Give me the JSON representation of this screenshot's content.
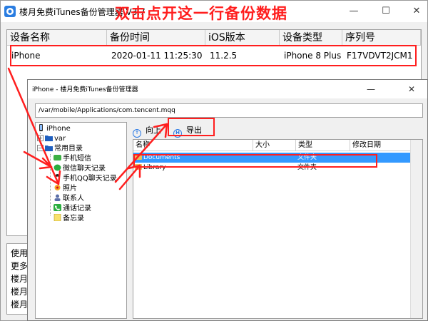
{
  "main_window": {
    "title": "楼月免费iTunes备份管理器 V3.7",
    "controls": {
      "minimize": "—",
      "maximize": "☐",
      "close": "✕"
    }
  },
  "annotation": {
    "caption": "双击点开这一行备份数据"
  },
  "backup_table": {
    "columns": [
      "设备名称",
      "备份时间",
      "iOS版本",
      "设备类型",
      "序列号"
    ],
    "rows": [
      {
        "device": "iPhone",
        "time": "2020-01-11  11:25:30",
        "ios": "11.2.5",
        "type": "iPhone 8 Plus",
        "serial": "F17VDVT2JCM1"
      }
    ]
  },
  "side_panel": {
    "lines": [
      "使用说",
      "更多软",
      "楼月微",
      "楼月手",
      "楼月手"
    ]
  },
  "dialog": {
    "title": "iPhone - 楼月免费iTunes备份管理器",
    "controls": {
      "minimize": "—",
      "close": "✕"
    },
    "path": "/var/mobile/Applications/com.tencent.mqq",
    "toolbar": {
      "up_label": "向上",
      "export_label": "导出"
    },
    "tree": {
      "root": "iPhone",
      "var": "var",
      "common": "常用目录",
      "items": [
        "手机短信",
        "微信聊天记录",
        "手机QQ聊天记录",
        "照片",
        "联系人",
        "通话记录",
        "备忘录"
      ]
    },
    "file_list": {
      "columns": [
        "名称",
        "大小",
        "类型",
        "修改日期"
      ],
      "rows": [
        {
          "name": "Documents",
          "size": "",
          "type": "文件夹",
          "date": ""
        },
        {
          "name": "Library",
          "size": "",
          "type": "文件夹",
          "date": ""
        }
      ]
    }
  },
  "colors": {
    "annotation_red": "#ff1e1e",
    "selection_blue": "#3399ff",
    "folder_yellow": "#e8c25a"
  }
}
